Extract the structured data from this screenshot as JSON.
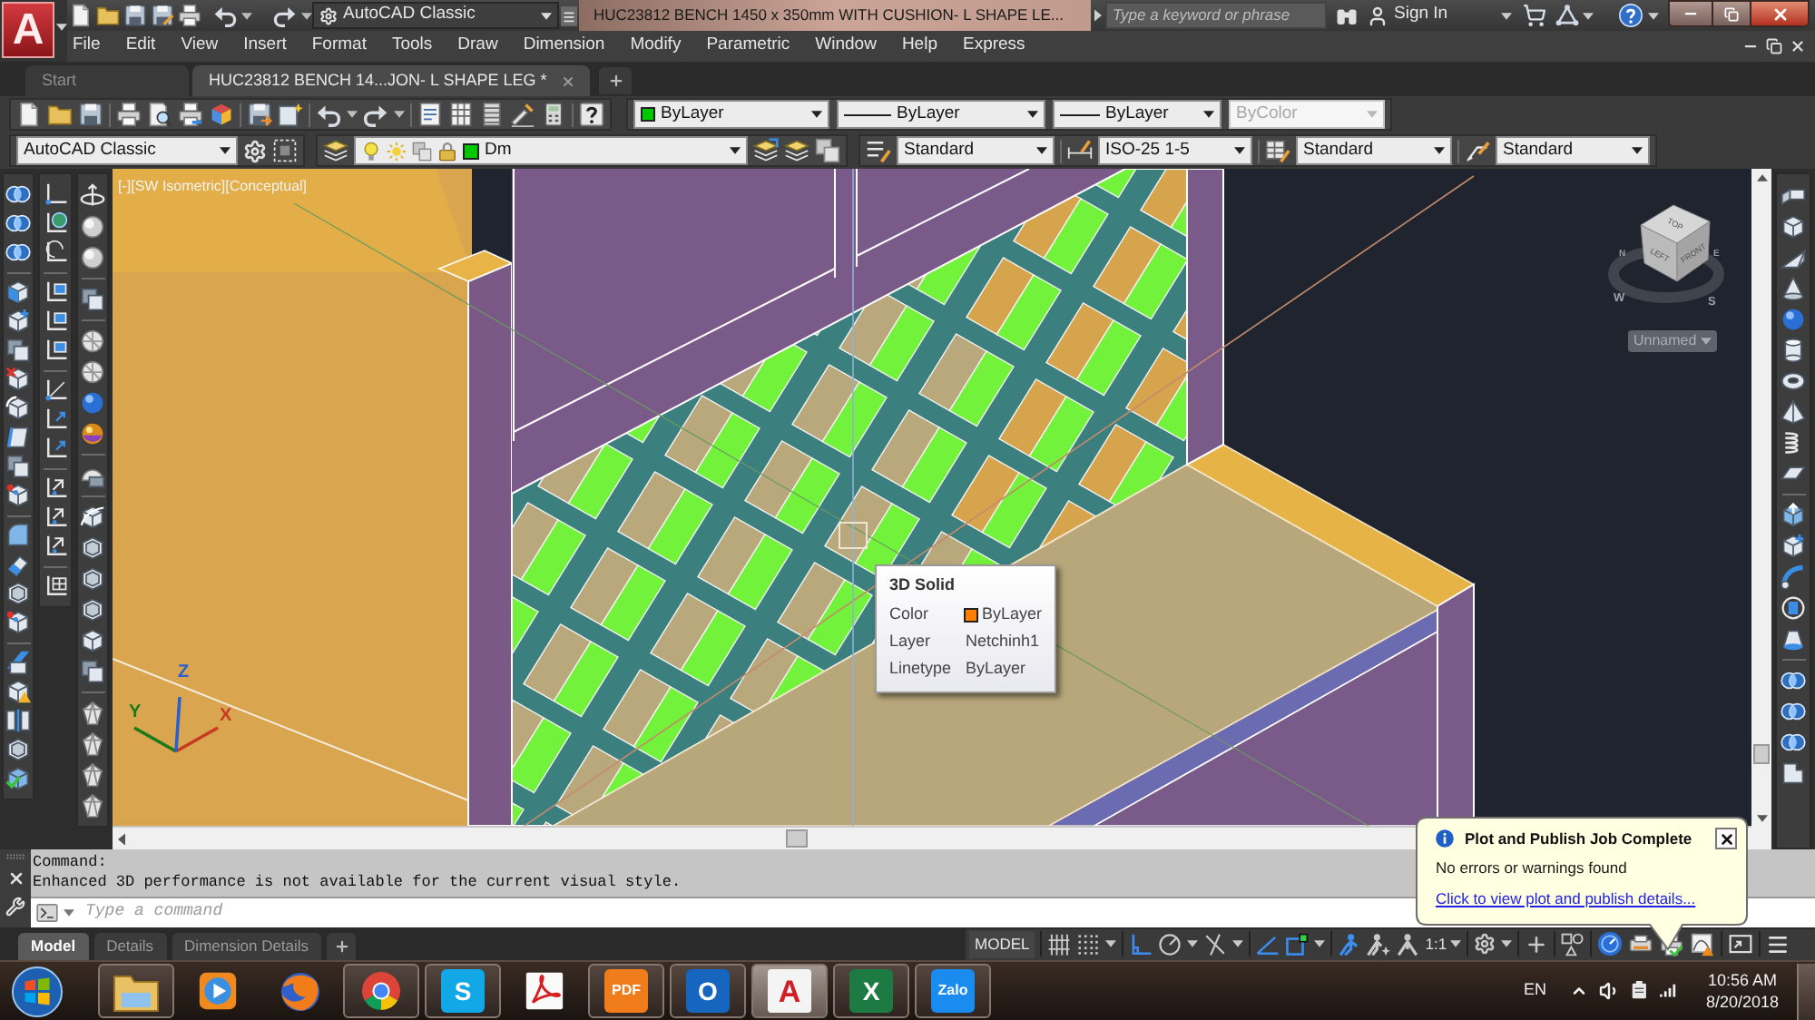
{
  "app_menu": {
    "glyph": "A"
  },
  "title_bar": {
    "workspace": "AutoCAD Classic",
    "title": "HUC23812 BENCH 1450 x 350mm WITH CUSHION- L SHAPE LE...",
    "search": {
      "placeholder": "Type a keyword or phrase"
    },
    "sign_in": "Sign In"
  },
  "menu": [
    "File",
    "Edit",
    "View",
    "Insert",
    "Format",
    "Tools",
    "Draw",
    "Dimension",
    "Modify",
    "Parametric",
    "Window",
    "Help",
    "Express"
  ],
  "file_tabs": [
    {
      "label": "Start",
      "selected": false
    },
    {
      "label": "HUC23812 BENCH 14...JON- L SHAPE LEG *",
      "selected": true
    }
  ],
  "properties_toolbar": {
    "color": {
      "value": "ByLayer",
      "color": "#00c800"
    },
    "linetype": "ByLayer",
    "lineweight": "ByLayer",
    "plot_style": {
      "value": "ByColor",
      "disabled": true
    }
  },
  "styles_toolbar": {
    "workspace": "AutoCAD Classic",
    "layer": {
      "name": "Dm",
      "color": "#00c800"
    },
    "text_style": "Standard",
    "dimension_style": "ISO-25 1-5",
    "table_style": "Standard",
    "multileader_style": "Standard"
  },
  "viewport": {
    "label": "[-][SW Isometric][Conceptual]",
    "ucs_axes": [
      {
        "label": "X",
        "color": "#c83a24"
      },
      {
        "label": "Y",
        "color": "#1a7a1a"
      },
      {
        "label": "Z",
        "color": "#2a5fd0"
      }
    ],
    "viewcube": {
      "faces": [
        "TOP",
        "LEFT",
        "FRONT"
      ],
      "compass": [
        "N",
        "E",
        "W",
        "S"
      ]
    },
    "named_view": "Unnamed"
  },
  "tooltip": {
    "title": "3D Solid",
    "rows": [
      {
        "label": "Color",
        "value": "ByLayer",
        "color": "#ff8000"
      },
      {
        "label": "Layer",
        "value": "Netchinh1"
      },
      {
        "label": "Linetype",
        "value": "ByLayer"
      }
    ]
  },
  "command_line": {
    "history": [
      "Command:",
      "Enhanced 3D performance is not available for the current visual style."
    ],
    "placeholder": "Type a command"
  },
  "layout_tabs": [
    {
      "label": "Model",
      "selected": true
    },
    {
      "label": "Details",
      "selected": false
    },
    {
      "label": "Dimension Details",
      "selected": false
    }
  ],
  "status_bar": {
    "space": "MODEL",
    "toggles": [
      {
        "kind": "grid",
        "on": false
      },
      {
        "kind": "snap",
        "on": false
      },
      {
        "kind": "ortho",
        "on": true
      },
      {
        "kind": "polar",
        "on": false
      },
      {
        "kind": "isodraft",
        "on": false
      },
      {
        "kind": "tracking",
        "on": true
      },
      {
        "kind": "osnap",
        "on": true
      },
      {
        "kind": "annotation_visibility",
        "on": true
      },
      {
        "kind": "autoscale",
        "on": false
      }
    ],
    "annotation_scale": "1:1",
    "hardware_acceleration": {
      "on": true
    }
  },
  "notification": {
    "title": "Plot and Publish Job Complete",
    "message": "No errors or warnings found",
    "link": "Click to view plot and publish details..."
  },
  "taskbar": {
    "apps": [
      {
        "kind": "folder",
        "running": true,
        "selected": false
      },
      {
        "kind": "player",
        "running": false,
        "selected": false
      },
      {
        "kind": "fox",
        "running": false,
        "selected": false
      },
      {
        "kind": "ring",
        "running": true,
        "selected": false
      },
      {
        "kind": "letter",
        "glyph": "S",
        "color": "#12a8e8",
        "running": true,
        "selected": false
      },
      {
        "kind": "swirl",
        "running": false,
        "selected": false
      },
      {
        "kind": "letter",
        "glyph": "PDF",
        "color": "#f07c1c",
        "running": true,
        "selected": false
      },
      {
        "kind": "letter",
        "glyph": "O",
        "color": "#1666c0",
        "running": true,
        "selected": false
      },
      {
        "kind": "letter_on_light",
        "glyph": "A",
        "color": "#d01f26",
        "running": true,
        "selected": true
      },
      {
        "kind": "letter",
        "glyph": "X",
        "color": "#1d7a43",
        "running": true,
        "selected": false
      },
      {
        "kind": "letter",
        "glyph": "Zalo",
        "color": "#1a8cf0",
        "running": true,
        "selected": false
      }
    ],
    "language": "EN",
    "time": "10:56 AM",
    "date": "8/20/2018"
  }
}
